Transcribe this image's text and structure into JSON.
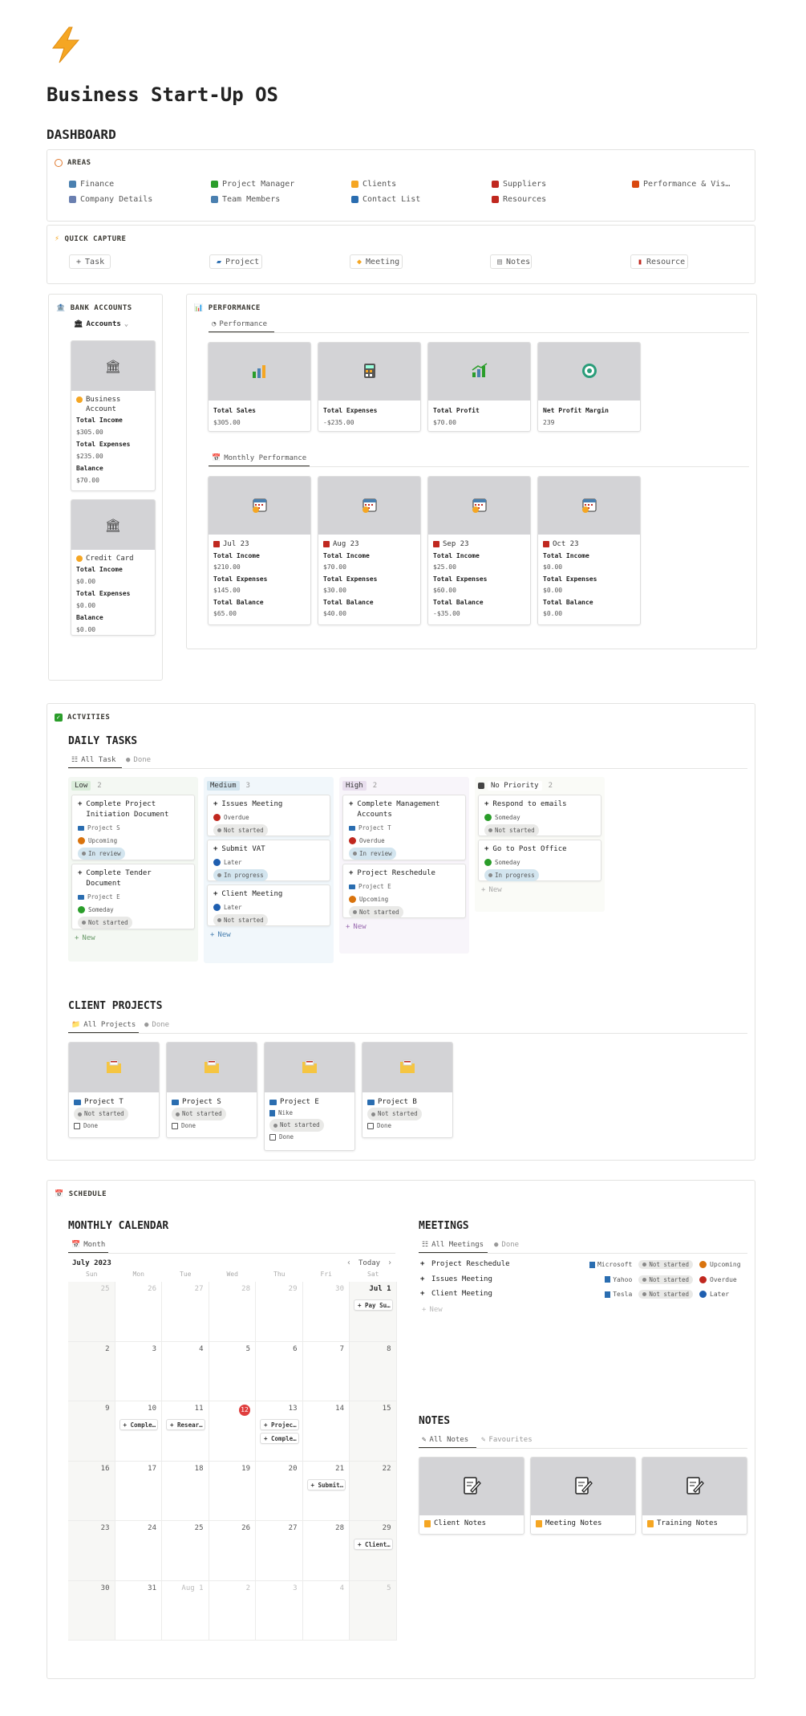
{
  "page": {
    "icon": "lightning-bolt-icon",
    "title": "Business Start-Up OS",
    "dashboard_heading": "DASHBOARD"
  },
  "areas": {
    "heading": "AREAS",
    "items": [
      {
        "label": "Finance",
        "icon": "bank-icon"
      },
      {
        "label": "Project Manager",
        "icon": "check-icon"
      },
      {
        "label": "Clients",
        "icon": "smile-icon"
      },
      {
        "label": "Suppliers",
        "icon": "truck-icon"
      },
      {
        "label": "Performance & Vis…",
        "icon": "target-icon"
      },
      {
        "label": "Company Details",
        "icon": "building-icon"
      },
      {
        "label": "Team Members",
        "icon": "person-icon"
      },
      {
        "label": "Contact List",
        "icon": "book-icon"
      },
      {
        "label": "Resources",
        "icon": "book-red-icon"
      }
    ]
  },
  "quick_capture": {
    "heading": "QUICK CAPTURE",
    "buttons": [
      {
        "label": "Task",
        "icon": "plus-icon"
      },
      {
        "label": "Project",
        "icon": "folder-icon"
      },
      {
        "label": "Meeting",
        "icon": "handshake-icon"
      },
      {
        "label": "Notes",
        "icon": "note-icon"
      },
      {
        "label": "Resource",
        "icon": "book-icon"
      }
    ]
  },
  "bank_accounts": {
    "heading": "BANK ACCOUNTS",
    "view_label": "Accounts",
    "accounts": [
      {
        "name": "Business Account",
        "income_label": "Total Income",
        "income": "$305.00",
        "expenses_label": "Total Expenses",
        "expenses": "$235.00",
        "balance_label": "Balance",
        "balance": "$70.00"
      },
      {
        "name": "Credit Card",
        "income_label": "Total Income",
        "income": "$0.00",
        "expenses_label": "Total Expenses",
        "expenses": "$0.00",
        "balance_label": "Balance",
        "balance": "$0.00"
      }
    ]
  },
  "performance": {
    "heading": "PERFORMANCE",
    "tab1": "Performance",
    "metrics": [
      {
        "label": "Total Sales",
        "value": "$305.00",
        "icon": "chart-icon"
      },
      {
        "label": "Total Expenses",
        "value": "-$235.00",
        "icon": "calculator-icon"
      },
      {
        "label": "Total Profit",
        "value": "$70.00",
        "icon": "profit-icon"
      },
      {
        "label": "Net Profit Margin",
        "value": "239",
        "icon": "target-green-icon"
      }
    ],
    "tab2": "Monthly Performance",
    "months": [
      {
        "month": "Jul 23",
        "income_label": "Total Income",
        "income": "$210.00",
        "expenses_label": "Total Expenses",
        "expenses": "$145.00",
        "balance_label": "Total Balance",
        "balance": "$65.00"
      },
      {
        "month": "Aug 23",
        "income_label": "Total Income",
        "income": "$70.00",
        "expenses_label": "Total Expenses",
        "expenses": "$30.00",
        "balance_label": "Total Balance",
        "balance": "$40.00"
      },
      {
        "month": "Sep 23",
        "income_label": "Total Income",
        "income": "$25.00",
        "expenses_label": "Total Expenses",
        "expenses": "$60.00",
        "balance_label": "Total Balance",
        "balance": "-$35.00"
      },
      {
        "month": "Oct 23",
        "income_label": "Total Income",
        "income": "$0.00",
        "expenses_label": "Total Expenses",
        "expenses": "$0.00",
        "balance_label": "Total Balance",
        "balance": "$0.00"
      }
    ]
  },
  "activities": {
    "heading": "ACTVITIES",
    "daily_tasks": {
      "title": "DAILY TASKS",
      "tab_all": "All Task",
      "tab_done": "Done",
      "columns": [
        {
          "name": "Low",
          "count": "2",
          "tag_bg": "#dbeddb",
          "col_bg": "#f4f8f3",
          "new_color": "#6a9a6a",
          "cards": [
            {
              "title": "Complete Project Initiation Document",
              "project": "Project S",
              "due": "Upcoming",
              "due_color": "#d9730d",
              "status": "In review",
              "status_bg": "#d3e5ef"
            },
            {
              "title": "Complete Tender Document",
              "project": "Project E",
              "due": "Someday",
              "due_color": "#2a9d2a",
              "status": "Not started",
              "status_bg": "#e9e9e7"
            }
          ]
        },
        {
          "name": "Medium",
          "count": "3",
          "tag_bg": "#d3e5ef",
          "col_bg": "#f1f7fb",
          "new_color": "#4a80b0",
          "cards": [
            {
              "title": "Issues Meeting",
              "project": "",
              "due": "Overdue",
              "due_color": "#c0281f",
              "status": "Not started",
              "status_bg": "#e9e9e7"
            },
            {
              "title": "Submit VAT",
              "project": "",
              "due": "Later",
              "due_color": "#1f5fb0",
              "status": "In progress",
              "status_bg": "#d3e5ef"
            },
            {
              "title": "Client Meeting",
              "project": "",
              "due": "Later",
              "due_color": "#1f5fb0",
              "status": "Not started",
              "status_bg": "#e9e9e7"
            }
          ]
        },
        {
          "name": "High",
          "count": "2",
          "tag_bg": "#e8deee",
          "col_bg": "#f8f5fa",
          "new_color": "#9a6ab0",
          "cards": [
            {
              "title": "Complete Management Accounts",
              "project": "Project T",
              "due": "Overdue",
              "due_color": "#c0281f",
              "status": "In review",
              "status_bg": "#d3e5ef"
            },
            {
              "title": "Project Reschedule",
              "project": "Project E",
              "due": "Upcoming",
              "due_color": "#d9730d",
              "status": "Not started",
              "status_bg": "#e9e9e7"
            }
          ]
        },
        {
          "name": "No Priority",
          "count": "2",
          "tag_bg": "#ffffff",
          "col_bg": "#fafbf7",
          "new_color": "#aaa",
          "cards": [
            {
              "title": "Respond to emails",
              "project": "",
              "due": "Someday",
              "due_color": "#2a9d2a",
              "status": "Not started",
              "status_bg": "#e9e9e7"
            },
            {
              "title": "Go to Post Office",
              "project": "",
              "due": "Someday",
              "due_color": "#2a9d2a",
              "status": "In progress",
              "status_bg": "#d3e5ef"
            }
          ]
        }
      ],
      "new_label": "New"
    },
    "client_projects": {
      "title": "CLIENT PROJECTS",
      "tab_all": "All Projects",
      "tab_done": "Done",
      "projects": [
        {
          "name": "Project T",
          "client": "",
          "status": "Not started",
          "done_label": "Done"
        },
        {
          "name": "Project S",
          "client": "",
          "status": "Not started",
          "done_label": "Done"
        },
        {
          "name": "Project E",
          "client": "Nike",
          "status": "Not started",
          "done_label": "Done"
        },
        {
          "name": "Project B",
          "client": "",
          "status": "Not started",
          "done_label": "Done"
        }
      ]
    }
  },
  "schedule": {
    "heading": "SCHEDULE",
    "calendar": {
      "title": "MONTHLY CALENDAR",
      "tab": "Month",
      "month_label": "July 2023",
      "today_label": "Today",
      "weekdays": [
        "Sun",
        "Mon",
        "Tue",
        "Wed",
        "Thu",
        "Fri",
        "Sat"
      ],
      "weeks": [
        [
          "25",
          "26",
          "27",
          "28",
          "29",
          "30",
          "Jul 1"
        ],
        [
          "2",
          "3",
          "4",
          "5",
          "6",
          "7",
          "8"
        ],
        [
          "9",
          "10",
          "11",
          "12",
          "13",
          "14",
          "15"
        ],
        [
          "16",
          "17",
          "18",
          "19",
          "20",
          "21",
          "22"
        ],
        [
          "23",
          "24",
          "25",
          "26",
          "27",
          "28",
          "29"
        ],
        [
          "30",
          "31",
          "Aug 1",
          "2",
          "3",
          "4",
          "5"
        ]
      ],
      "today": "12",
      "events": [
        {
          "label": "Pay Su…"
        },
        {
          "label": "Comple…"
        },
        {
          "label": "Resear…"
        },
        {
          "label": "Projec…"
        },
        {
          "label": "Comple…"
        },
        {
          "label": "Submit…"
        },
        {
          "label": "Client…"
        }
      ]
    },
    "meetings": {
      "title": "MEETINGS",
      "tab_all": "All Meetings",
      "tab_done": "Done",
      "items": [
        {
          "title": "Project Reschedule",
          "client": "Microsoft",
          "status": "Not started",
          "due": "Upcoming",
          "due_color": "#d9730d"
        },
        {
          "title": "Issues Meeting",
          "client": "Yahoo",
          "status": "Not started",
          "due": "Overdue",
          "due_color": "#c0281f"
        },
        {
          "title": "Client Meeting",
          "client": "Tesla",
          "status": "Not started",
          "due": "Later",
          "due_color": "#1f5fb0"
        }
      ],
      "new_label": "New"
    },
    "notes": {
      "title": "NOTES",
      "tab_all": "All Notes",
      "tab_fav": "Favourites",
      "items": [
        {
          "label": "Client Notes"
        },
        {
          "label": "Meeting Notes"
        },
        {
          "label": "Training Notes"
        }
      ]
    }
  }
}
